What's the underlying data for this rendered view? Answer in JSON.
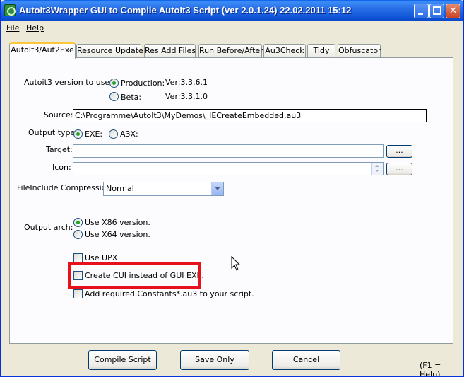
{
  "window": {
    "title": "AutoIt3Wrapper GUI to Compile AutoIt3 Script (ver 2.0.1.24) 22.02.2011 15:12",
    "controls": {
      "minimize": "minimize",
      "maximize": "maximize",
      "close": "✕"
    }
  },
  "menu": {
    "file": "File",
    "help": "Help"
  },
  "tabs": [
    {
      "label": "AutoIt3/Aut2Exe"
    },
    {
      "label": "Resource Update"
    },
    {
      "label": "Res Add Files"
    },
    {
      "label": "Run Before/After"
    },
    {
      "label": "Au3Check"
    },
    {
      "label": "Tidy"
    },
    {
      "label": "Obfuscator"
    }
  ],
  "autoit_version": {
    "label": "Autoit3 version to use:",
    "production_label": "Production:",
    "production_version": "Ver:3.3.6.1",
    "beta_label": "Beta:",
    "beta_version": "Ver:3.3.1.0",
    "selected": "production"
  },
  "source": {
    "label": "Source:",
    "value": "C:\\Programme\\AutoIt3\\MyDemos\\_IECreateEmbedded.au3"
  },
  "output_type": {
    "label": "Output type:",
    "exe": "EXE:",
    "a3x": "A3X:",
    "selected": "exe"
  },
  "target": {
    "label": "Target:",
    "value": "",
    "browse": "..."
  },
  "icon": {
    "label": "Icon:",
    "value": "",
    "browse": "..."
  },
  "compression": {
    "label": "FileInclude Compression:",
    "value": "Normal"
  },
  "output_arch": {
    "label": "Output arch:",
    "x86": "Use X86 version.",
    "x64": "Use X64 version.",
    "selected": "x86"
  },
  "options": {
    "use_upx": "Use UPX",
    "create_cui": "Create CUI instead of GUI EXE.",
    "add_constants": "Add required Constants*.au3 to your script."
  },
  "buttons": {
    "compile": "Compile Script",
    "save": "Save Only",
    "cancel": "Cancel"
  },
  "help_hint": "(F1 = Help)",
  "colors": {
    "highlight": "#e8101b",
    "titlebar": "#0a5ce8"
  }
}
